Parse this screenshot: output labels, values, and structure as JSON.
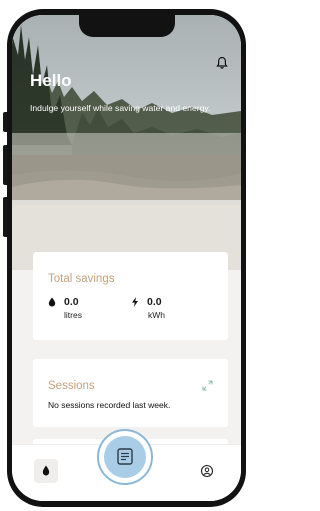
{
  "header": {
    "greeting": "Hello",
    "subtitle": "Indulge yourself while saving water and energy.",
    "notification_icon": "bell-icon"
  },
  "savings_card": {
    "title": "Total savings",
    "water": {
      "icon": "water-drop-icon",
      "value": "0.0",
      "unit": "litres"
    },
    "energy": {
      "icon": "lightning-bolt-icon",
      "value": "0.0",
      "unit": "kWh"
    }
  },
  "sessions_card": {
    "title": "Sessions",
    "expand_icon": "expand-icon",
    "message": "No sessions recorded last week."
  },
  "nav": {
    "left_icon": "water-drop-icon",
    "center_icon": "document-list-icon",
    "right_icon": "user-profile-icon"
  },
  "colors": {
    "accent_title": "#c7a07b",
    "fab_fill": "#a9cde6",
    "fab_ring": "#8bb8d8"
  }
}
